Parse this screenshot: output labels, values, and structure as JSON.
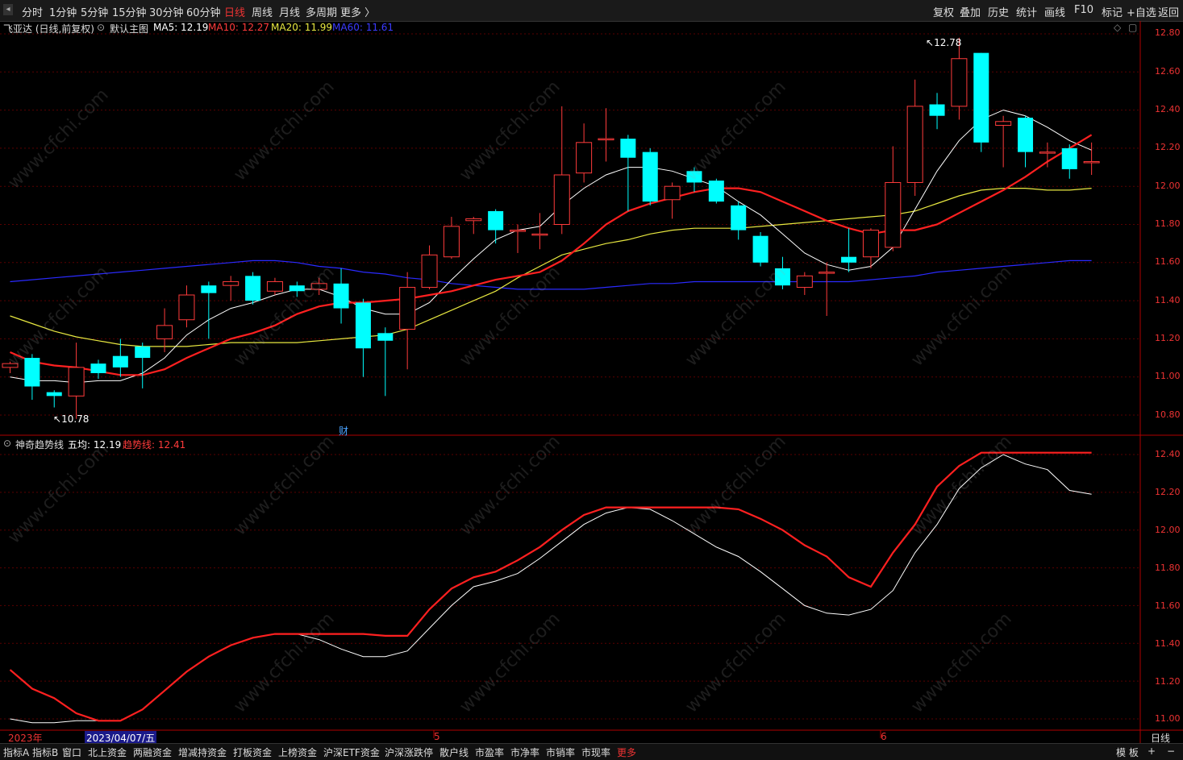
{
  "topbar": {
    "periods": [
      "分时",
      "1分钟",
      "5分钟",
      "15分钟",
      "30分钟",
      "60分钟",
      "日线",
      "周线",
      "月线",
      "多周期",
      "更多 〉"
    ],
    "active_period": "日线",
    "right_buttons": [
      "复权",
      "叠加",
      "历史",
      "统计",
      "画线",
      "F10",
      "标记",
      "+自选",
      "返回"
    ]
  },
  "main_chart": {
    "title": "飞亚达 (日线,前复权)",
    "template": "默认主图",
    "ma5": "MA5: 12.19",
    "ma10": "MA10: 12.27",
    "ma20": "MA20: 11.99",
    "ma60": "MA60: 11.61",
    "high_label": "12.78",
    "low_label": "10.78",
    "finance_marker": "财",
    "yticks": [
      "12.80",
      "12.60",
      "12.40",
      "12.20",
      "12.00",
      "11.80",
      "11.60",
      "11.40",
      "11.20",
      "11.00",
      "10.80"
    ]
  },
  "sub_chart": {
    "title": "神奇趋势线",
    "avg": "五均: 12.19",
    "trend": "趋势线: 12.41",
    "yticks": [
      "12.40",
      "12.20",
      "12.00",
      "11.80",
      "11.60",
      "11.40",
      "11.20",
      "11.00"
    ]
  },
  "x_axis": {
    "year": "2023年",
    "cursor_date": "2023/04/07/五",
    "month5": "5",
    "month6": "6",
    "period_label": "日线"
  },
  "watermark": "www.cfchi.com",
  "bottombar": {
    "tabs": [
      "指标A",
      "指标B",
      "窗口",
      "北上资金",
      "两融资金",
      "增减持资金",
      "打板资金",
      "上榜资金",
      "沪深ETF资金",
      "沪深涨跌停",
      "散户线",
      "市盈率",
      "市净率",
      "市销率",
      "市现率",
      "更多"
    ],
    "right": [
      "模 板",
      "+",
      "−"
    ]
  },
  "colors": {
    "up": "#ff3b3b",
    "down": "#00ffff",
    "ma5": "#ffffff",
    "ma10": "#ff2020",
    "ma20": "#e8e840",
    "ma60": "#2a2aff",
    "axis": "#b00000"
  },
  "chart_data": {
    "type": "candlestick",
    "price_range": [
      10.7,
      12.86
    ],
    "sub_range": [
      10.93,
      12.46
    ],
    "candles": [
      {
        "o": 11.05,
        "c": 11.07,
        "h": 11.08,
        "l": 11.02
      },
      {
        "o": 11.1,
        "c": 10.95,
        "h": 11.12,
        "l": 10.88
      },
      {
        "o": 10.92,
        "c": 10.9,
        "h": 10.93,
        "l": 10.84
      },
      {
        "o": 10.9,
        "c": 11.05,
        "h": 11.18,
        "l": 10.78
      },
      {
        "o": 11.07,
        "c": 11.02,
        "h": 11.09,
        "l": 10.99
      },
      {
        "o": 11.11,
        "c": 11.05,
        "h": 11.2,
        "l": 11.0
      },
      {
        "o": 11.16,
        "c": 11.1,
        "h": 11.18,
        "l": 10.94
      },
      {
        "o": 11.2,
        "c": 11.27,
        "h": 11.36,
        "l": 11.13
      },
      {
        "o": 11.3,
        "c": 11.43,
        "h": 11.48,
        "l": 11.26
      },
      {
        "o": 11.48,
        "c": 11.44,
        "h": 11.5,
        "l": 11.2
      },
      {
        "o": 11.48,
        "c": 11.5,
        "h": 11.53,
        "l": 11.4
      },
      {
        "o": 11.53,
        "c": 11.4,
        "h": 11.55,
        "l": 11.38
      },
      {
        "o": 11.45,
        "c": 11.5,
        "h": 11.52,
        "l": 11.43
      },
      {
        "o": 11.48,
        "c": 11.45,
        "h": 11.5,
        "l": 11.42
      },
      {
        "o": 11.46,
        "c": 11.49,
        "h": 11.52,
        "l": 11.43
      },
      {
        "o": 11.49,
        "c": 11.36,
        "h": 11.57,
        "l": 11.28
      },
      {
        "o": 11.39,
        "c": 11.15,
        "h": 11.41,
        "l": 11.0
      },
      {
        "o": 11.23,
        "c": 11.19,
        "h": 11.26,
        "l": 10.9
      },
      {
        "o": 11.25,
        "c": 11.47,
        "h": 11.55,
        "l": 11.04
      },
      {
        "o": 11.47,
        "c": 11.64,
        "h": 11.69,
        "l": 11.46
      },
      {
        "o": 11.63,
        "c": 11.79,
        "h": 11.84,
        "l": 11.62
      },
      {
        "o": 11.82,
        "c": 11.83,
        "h": 11.84,
        "l": 11.75
      },
      {
        "o": 11.87,
        "c": 11.77,
        "h": 11.88,
        "l": 11.7
      },
      {
        "o": 11.77,
        "c": 11.77,
        "h": 11.8,
        "l": 11.65
      },
      {
        "o": 11.75,
        "c": 11.75,
        "h": 11.86,
        "l": 11.67
      },
      {
        "o": 11.8,
        "c": 12.06,
        "h": 12.42,
        "l": 11.75
      },
      {
        "o": 12.07,
        "c": 12.23,
        "h": 12.33,
        "l": 12.02
      },
      {
        "o": 12.25,
        "c": 12.25,
        "h": 12.41,
        "l": 12.13
      },
      {
        "o": 12.25,
        "c": 12.15,
        "h": 12.27,
        "l": 11.87
      },
      {
        "o": 12.18,
        "c": 11.92,
        "h": 12.2,
        "l": 11.9
      },
      {
        "o": 11.93,
        "c": 12.0,
        "h": 12.02,
        "l": 11.83
      },
      {
        "o": 12.08,
        "c": 12.02,
        "h": 12.1,
        "l": 11.97
      },
      {
        "o": 12.03,
        "c": 11.92,
        "h": 12.04,
        "l": 11.91
      },
      {
        "o": 11.9,
        "c": 11.77,
        "h": 11.92,
        "l": 11.72
      },
      {
        "o": 11.74,
        "c": 11.6,
        "h": 11.76,
        "l": 11.58
      },
      {
        "o": 11.57,
        "c": 11.48,
        "h": 11.63,
        "l": 11.46
      },
      {
        "o": 11.47,
        "c": 11.53,
        "h": 11.55,
        "l": 11.43
      },
      {
        "o": 11.55,
        "c": 11.55,
        "h": 11.6,
        "l": 11.32
      },
      {
        "o": 11.63,
        "c": 11.6,
        "h": 11.78,
        "l": 11.55
      },
      {
        "o": 11.63,
        "c": 11.77,
        "h": 11.78,
        "l": 11.57
      },
      {
        "o": 11.68,
        "c": 12.02,
        "h": 12.21,
        "l": 11.66
      },
      {
        "o": 12.02,
        "c": 12.42,
        "h": 12.56,
        "l": 11.95
      },
      {
        "o": 12.43,
        "c": 12.37,
        "h": 12.49,
        "l": 12.3
      },
      {
        "o": 12.42,
        "c": 12.67,
        "h": 12.78,
        "l": 12.35
      },
      {
        "o": 12.7,
        "c": 12.23,
        "h": 12.7,
        "l": 12.18
      },
      {
        "o": 12.32,
        "c": 12.34,
        "h": 12.37,
        "l": 12.1
      },
      {
        "o": 12.36,
        "c": 12.18,
        "h": 12.37,
        "l": 12.1
      },
      {
        "o": 12.18,
        "c": 12.18,
        "h": 12.23,
        "l": 12.1
      },
      {
        "o": 12.2,
        "c": 12.09,
        "h": 12.22,
        "l": 12.04
      },
      {
        "o": 12.13,
        "c": 12.13,
        "h": 12.23,
        "l": 12.06
      }
    ],
    "ma5": [
      11.0,
      10.98,
      10.98,
      10.97,
      10.98,
      10.98,
      11.02,
      11.1,
      11.22,
      11.3,
      11.36,
      11.39,
      11.43,
      11.46,
      11.46,
      11.42,
      11.36,
      11.33,
      11.33,
      11.39,
      11.51,
      11.62,
      11.72,
      11.77,
      11.79,
      11.9,
      11.99,
      12.06,
      12.1,
      12.1,
      12.08,
      12.04,
      12.0,
      11.92,
      11.85,
      11.75,
      11.65,
      11.59,
      11.56,
      11.58,
      11.68,
      11.88,
      12.08,
      12.24,
      12.35,
      12.4,
      12.37,
      12.31,
      12.24,
      12.19
    ],
    "ma10": [
      11.13,
      11.08,
      11.06,
      11.05,
      11.03,
      11.01,
      11.01,
      11.04,
      11.1,
      11.15,
      11.2,
      11.23,
      11.27,
      11.33,
      11.37,
      11.39,
      11.39,
      11.4,
      11.41,
      11.43,
      11.45,
      11.48,
      11.51,
      11.53,
      11.55,
      11.61,
      11.7,
      11.8,
      11.87,
      11.91,
      11.94,
      11.97,
      11.99,
      11.99,
      11.97,
      11.92,
      11.87,
      11.82,
      11.78,
      11.75,
      11.77,
      11.77,
      11.8,
      11.86,
      11.92,
      11.98,
      12.05,
      12.13,
      12.2,
      12.27
    ],
    "ma20": [
      11.32,
      11.28,
      11.24,
      11.21,
      11.19,
      11.17,
      11.16,
      11.16,
      11.16,
      11.17,
      11.18,
      11.18,
      11.18,
      11.18,
      11.19,
      11.2,
      11.21,
      11.22,
      11.25,
      11.3,
      11.35,
      11.4,
      11.45,
      11.52,
      11.58,
      11.64,
      11.67,
      11.7,
      11.72,
      11.75,
      11.77,
      11.78,
      11.78,
      11.78,
      11.79,
      11.8,
      11.81,
      11.82,
      11.83,
      11.84,
      11.85,
      11.87,
      11.91,
      11.95,
      11.98,
      11.99,
      11.99,
      11.98,
      11.98,
      11.99
    ],
    "ma60": [
      11.5,
      11.51,
      11.52,
      11.53,
      11.54,
      11.55,
      11.56,
      11.57,
      11.58,
      11.59,
      11.6,
      11.61,
      11.61,
      11.6,
      11.58,
      11.57,
      11.55,
      11.54,
      11.52,
      11.51,
      11.49,
      11.48,
      11.47,
      11.46,
      11.46,
      11.46,
      11.46,
      11.47,
      11.48,
      11.49,
      11.49,
      11.5,
      11.5,
      11.5,
      11.5,
      11.5,
      11.5,
      11.5,
      11.5,
      11.51,
      11.52,
      11.53,
      11.55,
      11.56,
      11.57,
      11.58,
      11.59,
      11.6,
      11.61,
      11.61
    ],
    "sub_avg": [
      11.0,
      10.98,
      10.98,
      10.99,
      10.99,
      10.99,
      11.05,
      11.15,
      11.25,
      11.33,
      11.39,
      11.43,
      11.45,
      11.45,
      11.42,
      11.37,
      11.33,
      11.33,
      11.36,
      11.48,
      11.6,
      11.7,
      11.73,
      11.77,
      11.85,
      11.94,
      12.03,
      12.09,
      12.12,
      12.11,
      12.05,
      11.98,
      11.91,
      11.86,
      11.78,
      11.69,
      11.6,
      11.56,
      11.55,
      11.58,
      11.68,
      11.88,
      12.03,
      12.22,
      12.33,
      12.4,
      12.35,
      12.32,
      12.21,
      12.19
    ],
    "sub_trend": [
      11.26,
      11.16,
      11.11,
      11.03,
      10.99,
      10.99,
      11.05,
      11.15,
      11.25,
      11.33,
      11.39,
      11.43,
      11.45,
      11.45,
      11.45,
      11.45,
      11.45,
      11.44,
      11.44,
      11.58,
      11.69,
      11.75,
      11.78,
      11.84,
      11.91,
      12.0,
      12.08,
      12.12,
      12.12,
      12.12,
      12.12,
      12.12,
      12.12,
      12.11,
      12.06,
      12.0,
      11.92,
      11.86,
      11.75,
      11.7,
      11.88,
      12.03,
      12.23,
      12.34,
      12.41,
      12.41,
      12.41,
      12.41,
      12.41,
      12.41
    ]
  }
}
